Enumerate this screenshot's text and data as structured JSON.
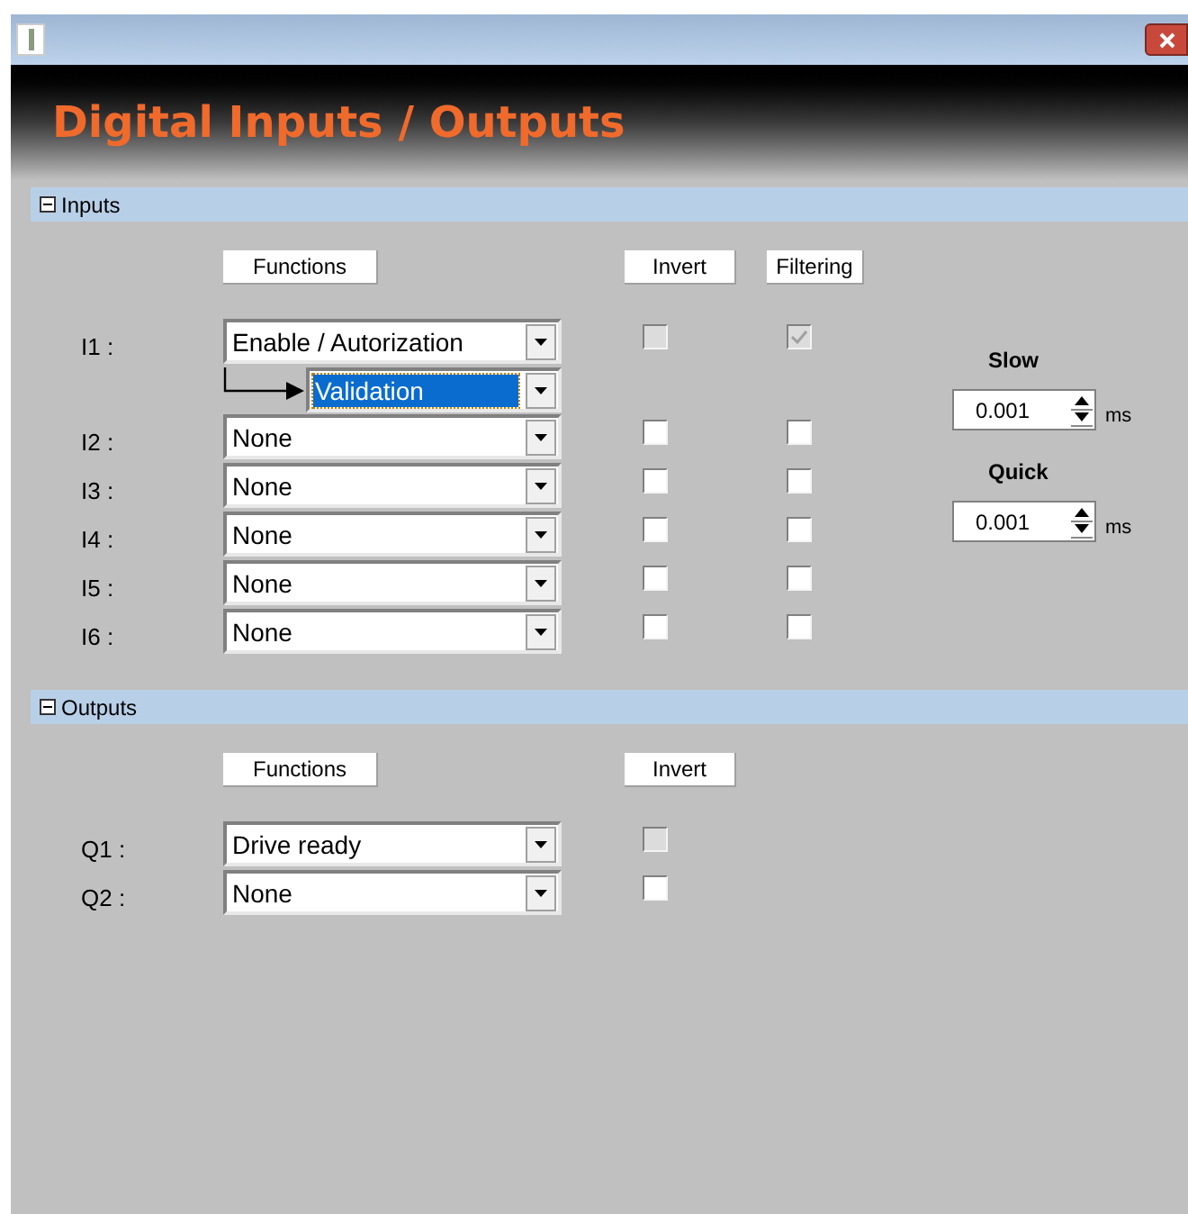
{
  "header": {
    "title": "Digital Inputs / Outputs"
  },
  "sections": [
    {
      "title": "Inputs",
      "expanded": true,
      "columns": [
        "Functions",
        "Invert",
        "Filtering"
      ],
      "rows": [
        {
          "label": "I1 :",
          "function": "Enable / Autorization",
          "sub_function": {
            "value": "Validation",
            "selected": true
          },
          "flags": [
            {
              "checked": false,
              "disabled": true
            },
            {
              "checked": true,
              "disabled": true
            }
          ]
        },
        {
          "label": "I2 :",
          "function": "None",
          "flags": [
            {
              "checked": false,
              "disabled": false
            },
            {
              "checked": false,
              "disabled": false
            }
          ]
        },
        {
          "label": "I3 :",
          "function": "None",
          "flags": [
            {
              "checked": false,
              "disabled": false
            },
            {
              "checked": false,
              "disabled": false
            }
          ]
        },
        {
          "label": "I4 :",
          "function": "None",
          "flags": [
            {
              "checked": false,
              "disabled": false
            },
            {
              "checked": false,
              "disabled": false
            }
          ]
        },
        {
          "label": "I5 :",
          "function": "None",
          "flags": [
            {
              "checked": false,
              "disabled": false
            },
            {
              "checked": false,
              "disabled": false
            }
          ]
        },
        {
          "label": "I6 :",
          "function": "None",
          "flags": [
            {
              "checked": false,
              "disabled": false
            },
            {
              "checked": false,
              "disabled": false
            }
          ]
        }
      ],
      "filter_times": [
        {
          "label": "Slow",
          "value": "0.001",
          "unit": "ms"
        },
        {
          "label": "Quick",
          "value": "0.001",
          "unit": "ms"
        }
      ]
    },
    {
      "title": "Outputs",
      "expanded": true,
      "columns": [
        "Functions",
        "Invert"
      ],
      "rows": [
        {
          "label": "Q1 :",
          "function": "Drive ready",
          "flags": [
            {
              "checked": false,
              "disabled": true
            }
          ]
        },
        {
          "label": "Q2 :",
          "function": "None",
          "flags": [
            {
              "checked": false,
              "disabled": false
            }
          ]
        }
      ]
    }
  ]
}
